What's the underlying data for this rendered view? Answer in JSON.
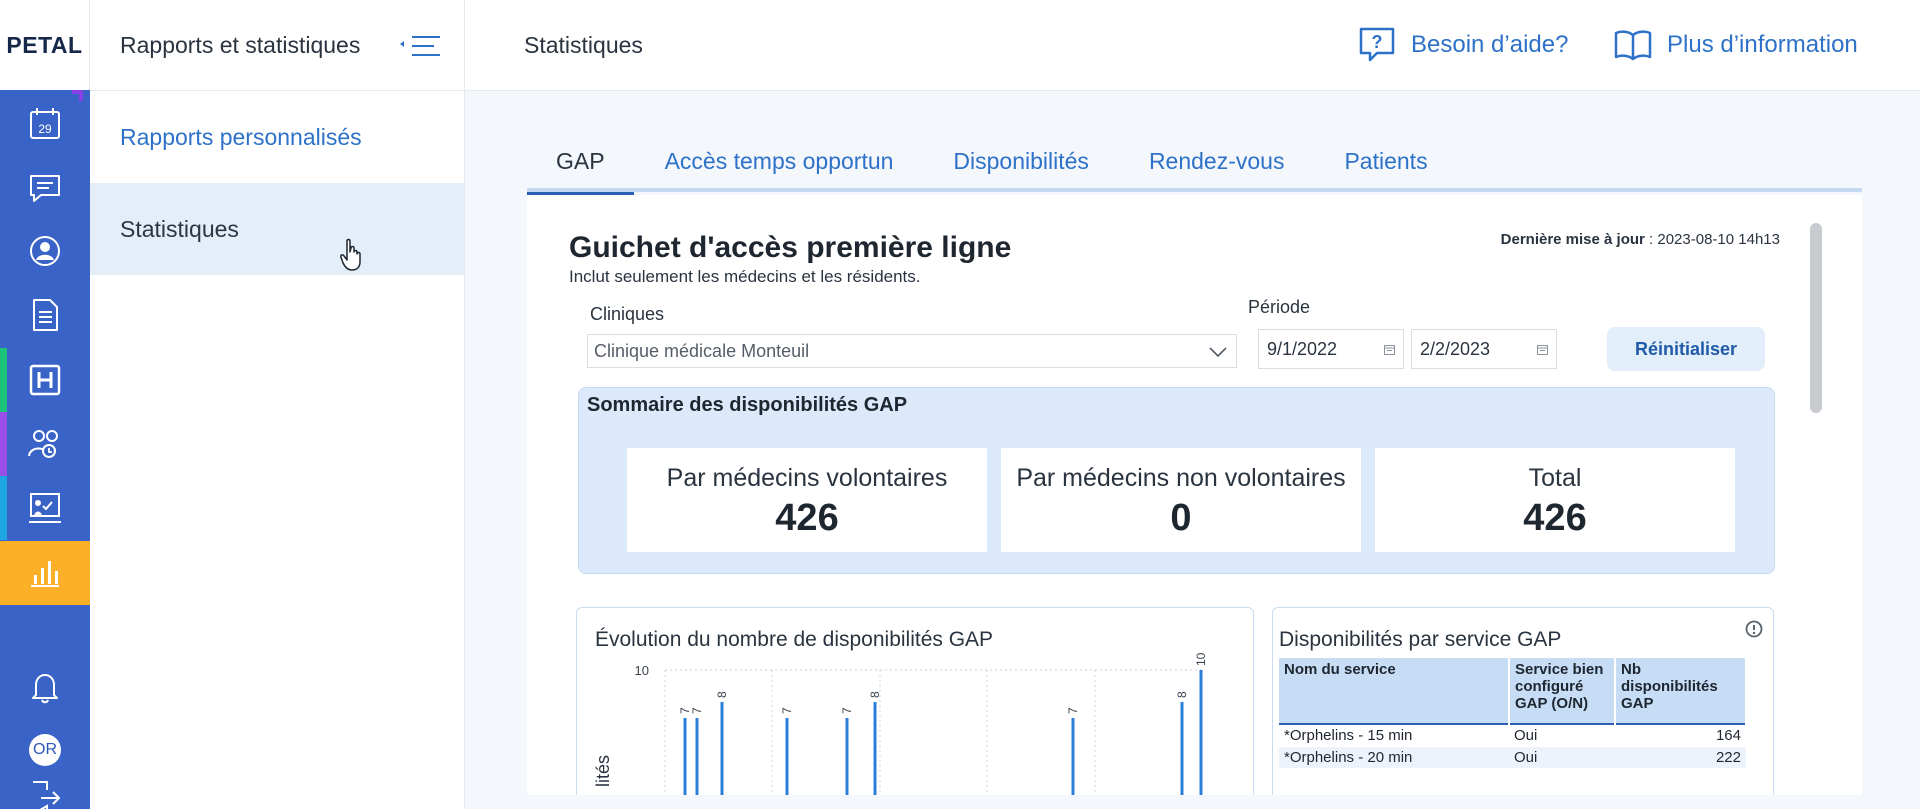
{
  "app": {
    "logo_text": "PETAL"
  },
  "rail": {
    "items": [
      {
        "name": "calendar-icon",
        "label": "29"
      },
      {
        "name": "chat-icon"
      },
      {
        "name": "user-icon"
      },
      {
        "name": "document-icon"
      },
      {
        "name": "hospital-icon",
        "accent": "#1ec37b"
      },
      {
        "name": "team-icon",
        "accent": "#9a4ee8"
      },
      {
        "name": "presentation-check-icon",
        "accent": "#1fa6e0"
      },
      {
        "name": "stats-icon",
        "active": true,
        "accent": "#fbb028"
      }
    ],
    "bell": "bell-icon",
    "avatar_initials": "OR",
    "logout": "logout-icon"
  },
  "subnav": {
    "title": "Rapports et statistiques",
    "items": [
      {
        "label": "Rapports personnalisés",
        "active": false
      },
      {
        "label": "Statistiques",
        "active": true
      }
    ]
  },
  "header": {
    "title": "Statistiques",
    "help_label": "Besoin d’aide?",
    "info_label": "Plus d’information"
  },
  "tabs": [
    {
      "label": "GAP",
      "active": true
    },
    {
      "label": "Accès temps opportun"
    },
    {
      "label": "Disponibilités"
    },
    {
      "label": "Rendez-vous"
    },
    {
      "label": "Patients"
    }
  ],
  "gap": {
    "title": "Guichet d'accès première ligne",
    "subtitle": "Inclut seulement les médecins et les résidents.",
    "last_update_label": "Dernière mise à jour",
    "last_update_value": " : 2023-08-10 14h13",
    "clinics_label": "Cliniques",
    "clinic_value": "Clinique médicale Monteuil",
    "period_label": "Période",
    "date_from": "9/1/2022",
    "date_to": "2/2/2023",
    "reset_label": "Réinitialiser",
    "summary": {
      "title": "Sommaire des disponibilités GAP",
      "stats": [
        {
          "label": "Par médecins volontaires",
          "value": "426"
        },
        {
          "label": "Par médecins non volontaires",
          "value": "0"
        },
        {
          "label": "Total",
          "value": "426"
        }
      ]
    },
    "evolution": {
      "title": "Évolution du nombre de disponibilités GAP",
      "ylabel_visible": "lités"
    },
    "services": {
      "title": "Disponibilités par service GAP",
      "columns": [
        "Nom du service",
        "Service bien configuré GAP (O/N)",
        "Nb disponibilités GAP"
      ],
      "rows": [
        [
          "*Orphelins - 15 min",
          "Oui",
          "164"
        ],
        [
          "*Orphelins - 20 min",
          "Oui",
          "222"
        ]
      ]
    }
  },
  "chart_data": {
    "type": "bar",
    "title": "Évolution du nombre de disponibilités GAP",
    "ylabel": "lités",
    "ylim": [
      0,
      10
    ],
    "y_ticks": [
      10
    ],
    "grid": true,
    "values": [
      7,
      7,
      8,
      7,
      7,
      8,
      7,
      8,
      10
    ],
    "data_labels": [
      "7",
      "7",
      "8",
      "7",
      "7",
      "8",
      "7",
      "8",
      "10"
    ],
    "bar_color": "#2b7fd8"
  }
}
